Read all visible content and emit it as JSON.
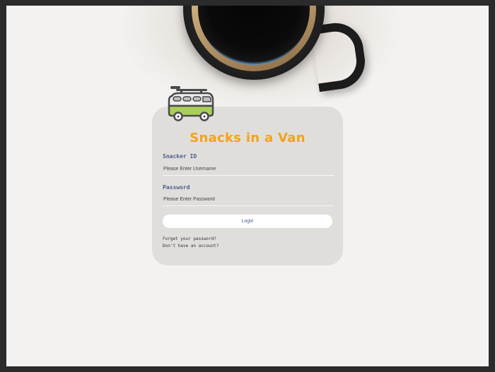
{
  "app": {
    "title": "Snacks in a Van"
  },
  "form": {
    "snacker_id_label": "Snacker ID",
    "snacker_id_placeholder": "Please Enter Username",
    "snacker_id_value": "",
    "password_label": "Password",
    "password_placeholder": "Please Enter Password",
    "password_value": "",
    "login_label": "Login"
  },
  "links": {
    "forgot_password": "Forget your password?",
    "no_account": "Don't have an account?"
  },
  "icons": {
    "logo": "camper-van-icon",
    "hero": "coffee-cup-image"
  },
  "colors": {
    "title": "#f5a21a",
    "label": "#4a5f8a",
    "card": "#dfdedb",
    "page": "#f4f2f0"
  }
}
